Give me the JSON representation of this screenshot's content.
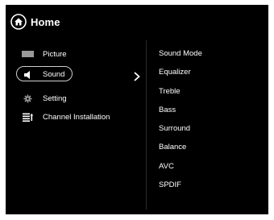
{
  "header": {
    "title": "Home",
    "icon": "home-icon"
  },
  "left_menu": {
    "items": [
      {
        "label": "Picture",
        "icon": "picture-icon",
        "selected": false
      },
      {
        "label": "Sound",
        "icon": "speaker-icon",
        "selected": true
      },
      {
        "label": "Setting",
        "icon": "gear-icon",
        "selected": false
      },
      {
        "label": "Channel Installation",
        "icon": "channel-list-icon",
        "selected": false
      }
    ]
  },
  "right_menu": {
    "items": [
      "Sound Mode",
      "Equalizer",
      "Treble",
      "Bass",
      "Surround",
      "Balance",
      "AVC",
      "SPDIF"
    ]
  },
  "colors": {
    "background": "#000000",
    "text": "#ffffff",
    "selection_outline": "#cfcfcf"
  }
}
